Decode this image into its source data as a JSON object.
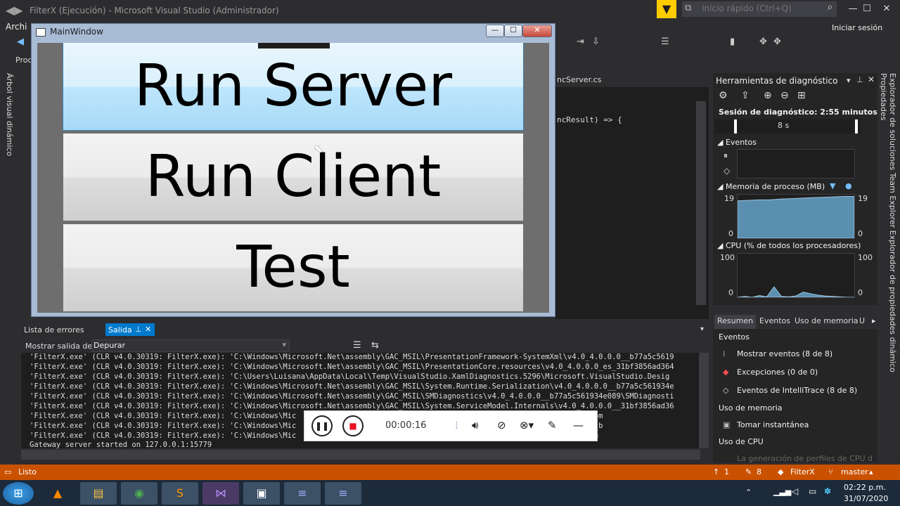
{
  "vs": {
    "title": "FilterX (Ejecución) - Microsoft Visual Studio  (Administrador)",
    "quick_launch_placeholder": "Inicio rápido (Ctrl+Q)",
    "menu_first": "Archi",
    "signin": "Iniciar sesión",
    "toolbar_left": "Proc",
    "left_vertical_tab": "Árbol visual dinámico"
  },
  "editor": {
    "tab_label": "ncServer.cs",
    "code_line": "ncResult) => {"
  },
  "main_window": {
    "title": "MainWindow",
    "buttons": {
      "run_server": "Run Server",
      "run_client": "Run Client",
      "test": "Test"
    }
  },
  "diagnostics": {
    "title": "Herramientas de diagnóstico",
    "session": "Sesión de diagnóstico: 2:55 minutos",
    "timeline_label": "8 s",
    "events_label": "Eventos",
    "memory_label": "Memoria de proceso (MB)",
    "memory_max": "19",
    "memory_min": "0",
    "cpu_label": "CPU (% de todos los procesadores)",
    "cpu_max": "100",
    "cpu_min": "0",
    "memory_series": [
      0.86,
      0.87,
      0.88,
      0.88,
      0.9,
      0.91,
      0.92,
      0.93,
      0.94,
      0.95,
      0.96,
      0.96
    ],
    "cpu_series": [
      0,
      2,
      0,
      4,
      1,
      24,
      2,
      1,
      3,
      12,
      8,
      5,
      3,
      2,
      1,
      0,
      0
    ],
    "tabs": [
      "Resumen",
      "Eventos",
      "Uso de memoria",
      "U"
    ],
    "summary": {
      "events_heading": "Eventos",
      "show_events": "Mostrar eventos (8 de 8)",
      "exceptions": "Excepciones (0 de 0)",
      "intellitrace": "Eventos de IntelliTrace (8 de 8)",
      "memory_heading": "Uso de memoria",
      "snapshot": "Tomar instantánea",
      "cpu_heading": "Uso de CPU",
      "cpu_note": "La generación de perfiles de CPU d"
    }
  },
  "right_vertical_tabs": "Explorador de soluciones   Team Explorer   Explorador de propiedades dinámico   Propiedades",
  "output": {
    "tab_errors": "Lista de errores",
    "tab_output": "Salida",
    "show_from_label": "Mostrar salida de:",
    "show_from_value": "Depurar",
    "lines": [
      "'FilterX.exe' (CLR v4.0.30319: FilterX.exe): 'C:\\Windows\\Microsoft.Net\\assembly\\GAC_MSIL\\PresentationFramework-SystemXml\\v4.0_4.0.0.0__b77a5c5619",
      "'FilterX.exe' (CLR v4.0.30319: FilterX.exe): 'C:\\Windows\\Microsoft.Net\\assembly\\GAC_MSIL\\PresentationCore.resources\\v4.0_4.0.0.0_es_31bf3856ad364",
      "'FilterX.exe' (CLR v4.0.30319: FilterX.exe): 'C:\\Users\\Luisana\\AppData\\Local\\Temp\\VisualStudio.XamlDiagnostics.5296\\Microsoft.VisualStudio.Desig",
      "'FilterX.exe' (CLR v4.0.30319: FilterX.exe): 'C:\\Windows\\Microsoft.Net\\assembly\\GAC_MSIL\\System.Runtime.Serialization\\v4.0_4.0.0.0__b77a5c561934e",
      "'FilterX.exe' (CLR v4.0.30319: FilterX.exe): 'C:\\Windows\\Microsoft.Net\\assembly\\GAC_MSIL\\SMDiagnostics\\v4.0_4.0.0.0__b77a5c561934e089\\SMDiagnosti",
      "'FilterX.exe' (CLR v4.0.30319: FilterX.exe): 'C:\\Windows\\Microsoft.Net\\assembly\\GAC_MSIL\\System.ServiceModel.Internals\\v4.0_4.0.0.0__31bf3856ad36",
      "'FilterX.exe' (CLR v4.0.30319: FilterX.exe): 'C:\\Windows\\Mic                                               3f3856ad364e35\\UIAutom",
      "'FilterX.exe' (CLR v4.0.30319: FilterX.exe): 'C:\\Windows\\Mic                                               rces\\v4.0_4.0.0.0_es_b",
      "'FilterX.exe' (CLR v4.0.30319: FilterX.exe): 'C:\\Windows\\Mic                                               31bf3856ad364e35\\UIAu",
      "Gateway server started on 127.0.0.1:15779"
    ]
  },
  "recorder": {
    "time": "00:00:16"
  },
  "status": {
    "ready": "Listo",
    "up_count": "1",
    "pencil_count": "8",
    "repo": "FilterX",
    "branch": "master"
  },
  "taskbar": {
    "time": "02:22 p.m.",
    "date": "31/07/2020"
  },
  "colors": {
    "vs_bg": "#2d2d30",
    "accent": "#007acc",
    "status_orange": "#ca5100",
    "filter_yellow": "#ffcc00"
  }
}
